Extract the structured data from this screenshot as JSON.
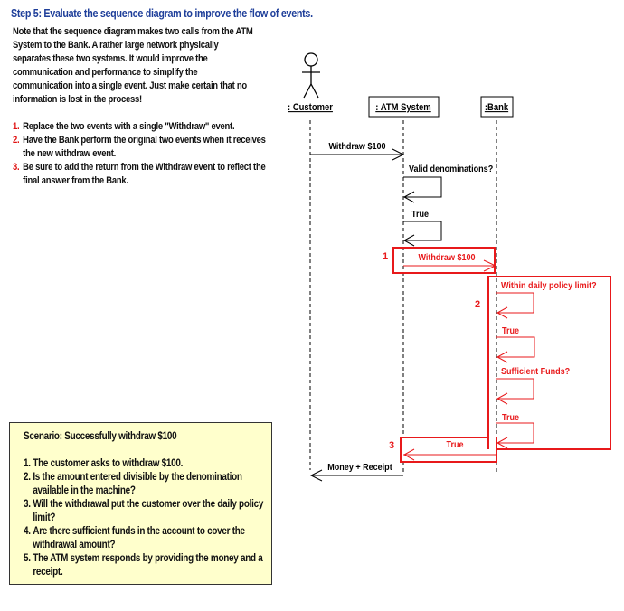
{
  "header": {
    "title": "Step 5: Evaluate the sequence diagram to improve the flow of events."
  },
  "intro": {
    "text": "Note that the sequence diagram makes two calls from the ATM System to the Bank.  A rather large network physically separates these two systems.  It would improve the communication and performance to simplify the communication into a single event.  Just make certain that no information is lost in the process!"
  },
  "instructions": [
    {
      "num": "1.",
      "text": "Replace the two events with a single \"Withdraw\" event."
    },
    {
      "num": "2.",
      "text": "Have the Bank perform the original two events when it receives the new withdraw event."
    },
    {
      "num": "3.",
      "text": "Be sure to add the return from the Withdraw event to reflect the final answer from the Bank."
    }
  ],
  "scenario": {
    "title": "Scenario:  Successfully withdraw $100",
    "steps": [
      {
        "num": "1.",
        "text": "The customer asks to withdraw $100."
      },
      {
        "num": "2.",
        "text": "Is the amount entered divisible by the denomination available in the machine?"
      },
      {
        "num": "3.",
        "text": "Will the withdrawal put the customer over the daily policy limit?"
      },
      {
        "num": "4.",
        "text": "Are there sufficient funds in the account to cover the withdrawal amount?"
      },
      {
        "num": "5.",
        "text": "The ATM system responds by providing the money and a receipt."
      }
    ]
  },
  "diagram": {
    "participants": {
      "customer": ": Customer",
      "atm": ": ATM System",
      "bank": ":Bank"
    },
    "messages": {
      "withdraw_request": "Withdraw $100",
      "valid_denominations": "Valid denominations?",
      "true_1": "True",
      "withdraw_to_bank": "Withdraw $100",
      "within_limit": "Within daily policy limit?",
      "true_2": "True",
      "sufficient_funds": "Sufficient Funds?",
      "true_3": "True",
      "bank_return": "True",
      "money_receipt": "Money + Receipt"
    },
    "markers": {
      "m1": "1",
      "m2": "2",
      "m3": "3"
    },
    "colors": {
      "highlight": "#e8191b",
      "line": "#000000",
      "title": "#1f3f9a",
      "note_bg": "#ffffcc"
    }
  }
}
